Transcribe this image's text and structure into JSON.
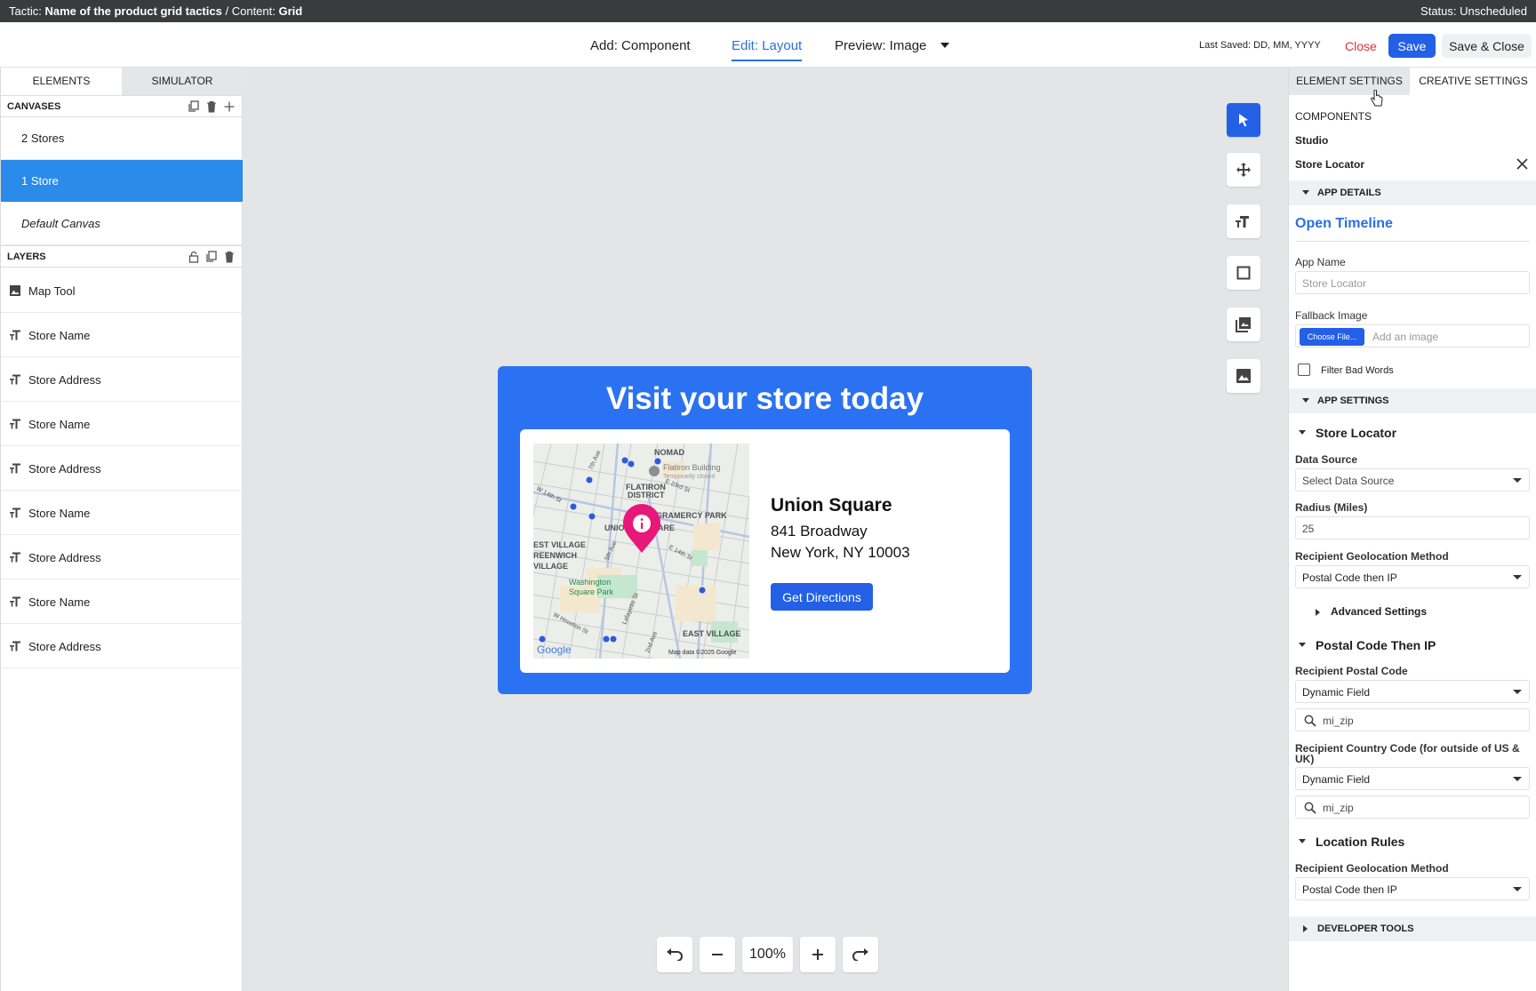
{
  "topbar": {
    "tactic_label": "Tactic:",
    "tactic_value": "Name of the product grid tactics",
    "separator": "/",
    "content_label": "Content:",
    "content_value": "Grid",
    "status": "Status: Unscheduled"
  },
  "header": {
    "add": "Add: Component",
    "edit": "Edit: Layout",
    "preview": "Preview: Image",
    "last_saved": "Last Saved: DD, MM, YYYY",
    "close": "Close",
    "save": "Save",
    "save_close": "Save & Close"
  },
  "left": {
    "tabs": [
      "ELEMENTS",
      "SIMULATOR"
    ],
    "canvases_title": "CANVASES",
    "canvases": [
      "2 Stores",
      "1 Store",
      "Default Canvas"
    ],
    "layers_title": "LAYERS",
    "layers": [
      {
        "label": "Map Tool",
        "icon": "image-icon"
      },
      {
        "label": "Store Name",
        "icon": "text-icon"
      },
      {
        "label": "Store Address",
        "icon": "text-icon"
      },
      {
        "label": "Store Name",
        "icon": "text-icon"
      },
      {
        "label": "Store Address",
        "icon": "text-icon"
      },
      {
        "label": "Store Name",
        "icon": "text-icon"
      },
      {
        "label": "Store Address",
        "icon": "text-icon"
      },
      {
        "label": "Store Name",
        "icon": "text-icon"
      },
      {
        "label": "Store Address",
        "icon": "text-icon"
      }
    ]
  },
  "creative": {
    "title": "Visit your store today",
    "store_name": "Union Square",
    "address_line1": "841 Broadway",
    "address_line2": "New York, NY 10003",
    "button": "Get Directions",
    "map": {
      "labels": [
        "NOMAD",
        "Flatiron Building",
        "Temporarily closed",
        "FLATIRON",
        "DISTRICT",
        "GRAMERCY PARK",
        "UNIO",
        "ARE",
        "EST VILLAGE",
        "REENWICH",
        "VILLAGE",
        "Washington",
        "Square Park",
        "EAST VILLAGE",
        "7th Ave",
        "W 14th St",
        "E 23rd St",
        "5th Ave",
        "E 14th St",
        "Lafayette St",
        "W Houston St",
        "2nd Ave"
      ],
      "attribution": "Map data ©2025 Google",
      "logo": "Google"
    }
  },
  "zoom": {
    "value": "100%"
  },
  "right": {
    "tabs": [
      "ELEMENT SETTINGS",
      "CREATIVE SETTINGS"
    ],
    "components_label": "COMPONENTS",
    "studio": "Studio",
    "store_locator": "Store Locator",
    "app_details": "APP DETAILS",
    "open_timeline": "Open Timeline",
    "app_name_label": "App Name",
    "app_name_placeholder": "Store Locator",
    "fallback_label": "Fallback Image",
    "choose_file": "Choose File...",
    "add_image": "Add an image",
    "filter_bad_words": "Filter Bad Words",
    "app_settings": "APP SETTINGS",
    "store_locator_sub": "Store Locator",
    "data_source_label": "Data Source",
    "data_source_value": "Select Data Source",
    "radius_label": "Radius (Miles)",
    "radius_value": "25",
    "geo_label": "Recipient Geolocation Method",
    "geo_value": "Postal Code then IP",
    "advanced": "Advanced Settings",
    "postal_sub": "Postal Code Then IP",
    "postal_label": "Recipient Postal Code",
    "postal_value": "Dynamic Field",
    "postal_search": "mi_zip",
    "country_label": "Recipient Country Code (for outside of US & UK)",
    "country_value": "Dynamic Field",
    "country_search": "mi_zip",
    "location_rules": "Location Rules",
    "geo2_label": "Recipient Geolocation Method",
    "geo2_value": "Postal Code then IP",
    "developer_tools": "DEVELOPER TOOLS"
  },
  "colors": {
    "accent": "#2360e6",
    "canvas_selected": "#2a8bea",
    "creative_bg": "#2b72f2",
    "close": "#e0303b",
    "pin": "#e8177a"
  }
}
